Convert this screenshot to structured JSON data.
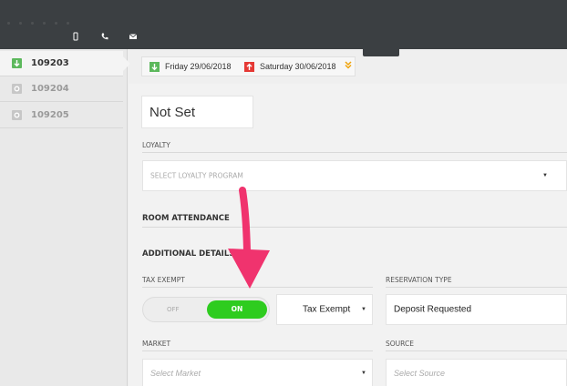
{
  "topbar": {
    "icons": [
      "mobile-icon",
      "phone-icon",
      "mail-icon"
    ]
  },
  "sidebar": {
    "items": [
      {
        "label": "109203",
        "status": "arrival",
        "active": true
      },
      {
        "label": "109204",
        "status": "pending",
        "active": false
      },
      {
        "label": "109205",
        "status": "pending",
        "active": false
      }
    ]
  },
  "dates": {
    "arrival": "Friday 29/06/2018",
    "departure": "Saturday 30/06/2018"
  },
  "form": {
    "status_value": "Not Set",
    "loyalty": {
      "label": "LOYALTY",
      "placeholder": "SELECT LOYALTY PROGRAM"
    },
    "room_attendance": "ROOM ATTENDANCE",
    "additional_details": "ADDITIONAL DETAILS",
    "tax_exempt": {
      "label": "TAX EXEMPT",
      "off": "OFF",
      "on": "ON",
      "state": "on",
      "type_value": "Tax Exempt"
    },
    "reservation_type": {
      "label": "RESERVATION TYPE",
      "value": "Deposit Requested"
    },
    "market": {
      "label": "MARKET",
      "placeholder": "Select Market"
    },
    "source": {
      "label": "SOURCE",
      "placeholder": "Select Source"
    }
  },
  "colors": {
    "accent_green": "#2ecc1f",
    "arrival_green": "#5cb85c",
    "departure_red": "#e53935",
    "annotation_pink": "#f0336e",
    "chevron_orange": "#f0a30a"
  }
}
